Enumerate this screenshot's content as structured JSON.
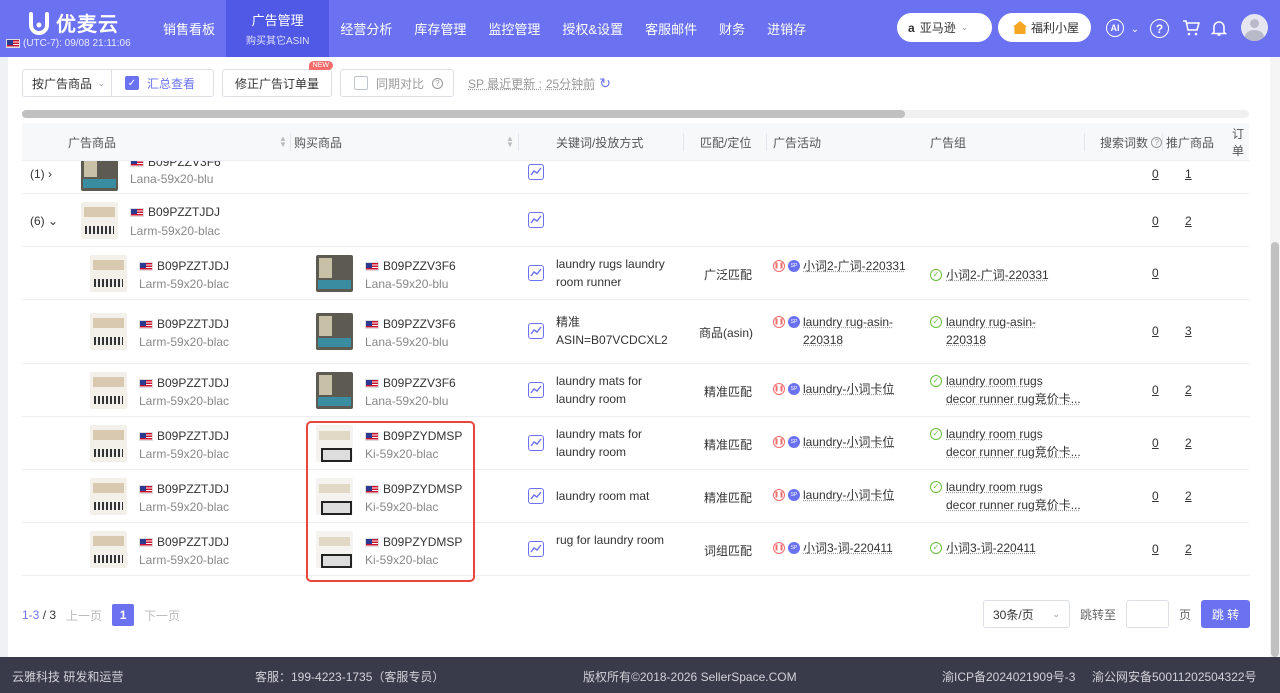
{
  "brand": {
    "name": "优麦云",
    "timezone": "(UTC-7): 09/08 21:11:06"
  },
  "nav": [
    {
      "label": "销售看板"
    },
    {
      "label": "广告管理",
      "sub": "购买其它ASIN"
    },
    {
      "label": "经营分析"
    },
    {
      "label": "库存管理"
    },
    {
      "label": "监控管理"
    },
    {
      "label": "授权&设置"
    },
    {
      "label": "客服邮件"
    },
    {
      "label": "财务"
    },
    {
      "label": "进销存"
    }
  ],
  "header": {
    "marketplace": "亚马逊",
    "welfare": "福利小屋",
    "ai": "AI",
    "help": "?"
  },
  "toolbar": {
    "group_by": "按广告商品",
    "summary": "汇总查看",
    "fix_orders": "修正广告订单量",
    "new_badge": "NEW",
    "compare": "同期对比",
    "update_prefix": "SP 最近更新 :",
    "update_time": "25分钟前"
  },
  "columns": {
    "ad_product": "广告商品",
    "bought_product": "购买商品",
    "keyword": "关键词/投放方式",
    "match": "匹配/定位",
    "campaign": "广告活动",
    "ad_group": "广告组",
    "search_terms": "搜索词数",
    "promoted": "推广商品",
    "orders": "订单"
  },
  "rows": [
    {
      "expand": "(1)",
      "asin": "B09PZZV3F6",
      "variant": "Lana-59x20-blu",
      "search_terms": "0",
      "promoted": "1"
    },
    {
      "expand": "(6)",
      "asin": "B09PZZTJDJ",
      "variant": "Larm-59x20-blac",
      "search_terms": "0",
      "promoted": "2"
    },
    {
      "asin": "B09PZZTJDJ",
      "variant": "Larm-59x20-blac",
      "b_asin": "B09PZZV3F6",
      "b_variant": "Lana-59x20-blu",
      "kw1": "laundry rugs laundry",
      "kw2": "room runner",
      "match": "广泛匹配",
      "camp1": "小词2-广词-220331",
      "camp2": "",
      "grp1": "小词2-广词-220331",
      "grp2": "",
      "search_terms": "0",
      "promoted": ""
    },
    {
      "asin": "B09PZZTJDJ",
      "variant": "Larm-59x20-blac",
      "b_asin": "B09PZZV3F6",
      "b_variant": "Lana-59x20-blu",
      "kw1": "精准",
      "kw2": "ASIN=B07VCDCXL2",
      "match": "商品(asin)",
      "camp1": "laundry rug-asin-",
      "camp2": "220318",
      "grp1": "laundry rug-asin-",
      "grp2": "220318",
      "search_terms": "0",
      "promoted": "3"
    },
    {
      "asin": "B09PZZTJDJ",
      "variant": "Larm-59x20-blac",
      "b_asin": "B09PZZV3F6",
      "b_variant": "Lana-59x20-blu",
      "kw1": "laundry mats for",
      "kw2": "laundry room",
      "match": "精准匹配",
      "camp1": "laundry-小词卡位",
      "camp2": "",
      "grp1": "laundry room rugs",
      "grp2": "decor runner rug竞价卡...",
      "search_terms": "0",
      "promoted": "2"
    },
    {
      "asin": "B09PZZTJDJ",
      "variant": "Larm-59x20-blac",
      "b_asin": "B09PZYDMSP",
      "b_variant": "Ki-59x20-blac",
      "kw1": "laundry mats for",
      "kw2": "laundry room",
      "match": "精准匹配",
      "camp1": "laundry-小词卡位",
      "camp2": "",
      "grp1": "laundry room rugs",
      "grp2": "decor runner rug竞价卡...",
      "search_terms": "0",
      "promoted": "2"
    },
    {
      "asin": "B09PZZTJDJ",
      "variant": "Larm-59x20-blac",
      "b_asin": "B09PZYDMSP",
      "b_variant": "Ki-59x20-blac",
      "kw1": "laundry room mat",
      "kw2": "",
      "match": "精准匹配",
      "camp1": "laundry-小词卡位",
      "camp2": "",
      "grp1": "laundry room rugs",
      "grp2": "decor runner rug竞价卡...",
      "search_terms": "0",
      "promoted": "2"
    },
    {
      "asin": "B09PZZTJDJ",
      "variant": "Larm-59x20-blac",
      "b_asin": "B09PZYDMSP",
      "b_variant": "Ki-59x20-blac",
      "kw1": "rug for laundry room",
      "kw2": "",
      "match": "词组匹配",
      "camp1": "小词3-词-220411",
      "camp2": "",
      "grp1": "小词3-词-220411",
      "grp2": "",
      "search_terms": "0",
      "promoted": "2"
    }
  ],
  "pager": {
    "range": "1-3",
    "total": "/ 3",
    "prev": "上一页",
    "current": "1",
    "next": "下一页",
    "size": "30条/页",
    "jump_label": "跳转至",
    "page_unit": "页",
    "go": "跳 转"
  },
  "footer": {
    "company": "云雅科技 研发和运营",
    "service": "客服：199-4223-1735（客服专员）",
    "copyright": "版权所有©2018-2026 SellerSpace.COM",
    "icp": "渝ICP备2024021909号-3",
    "police": "渝公网安备50011202504322号"
  },
  "colors": {
    "primary": "#6b72f2",
    "highlight": "#e8453c",
    "success": "#67c23a",
    "danger": "#f56c6c"
  }
}
